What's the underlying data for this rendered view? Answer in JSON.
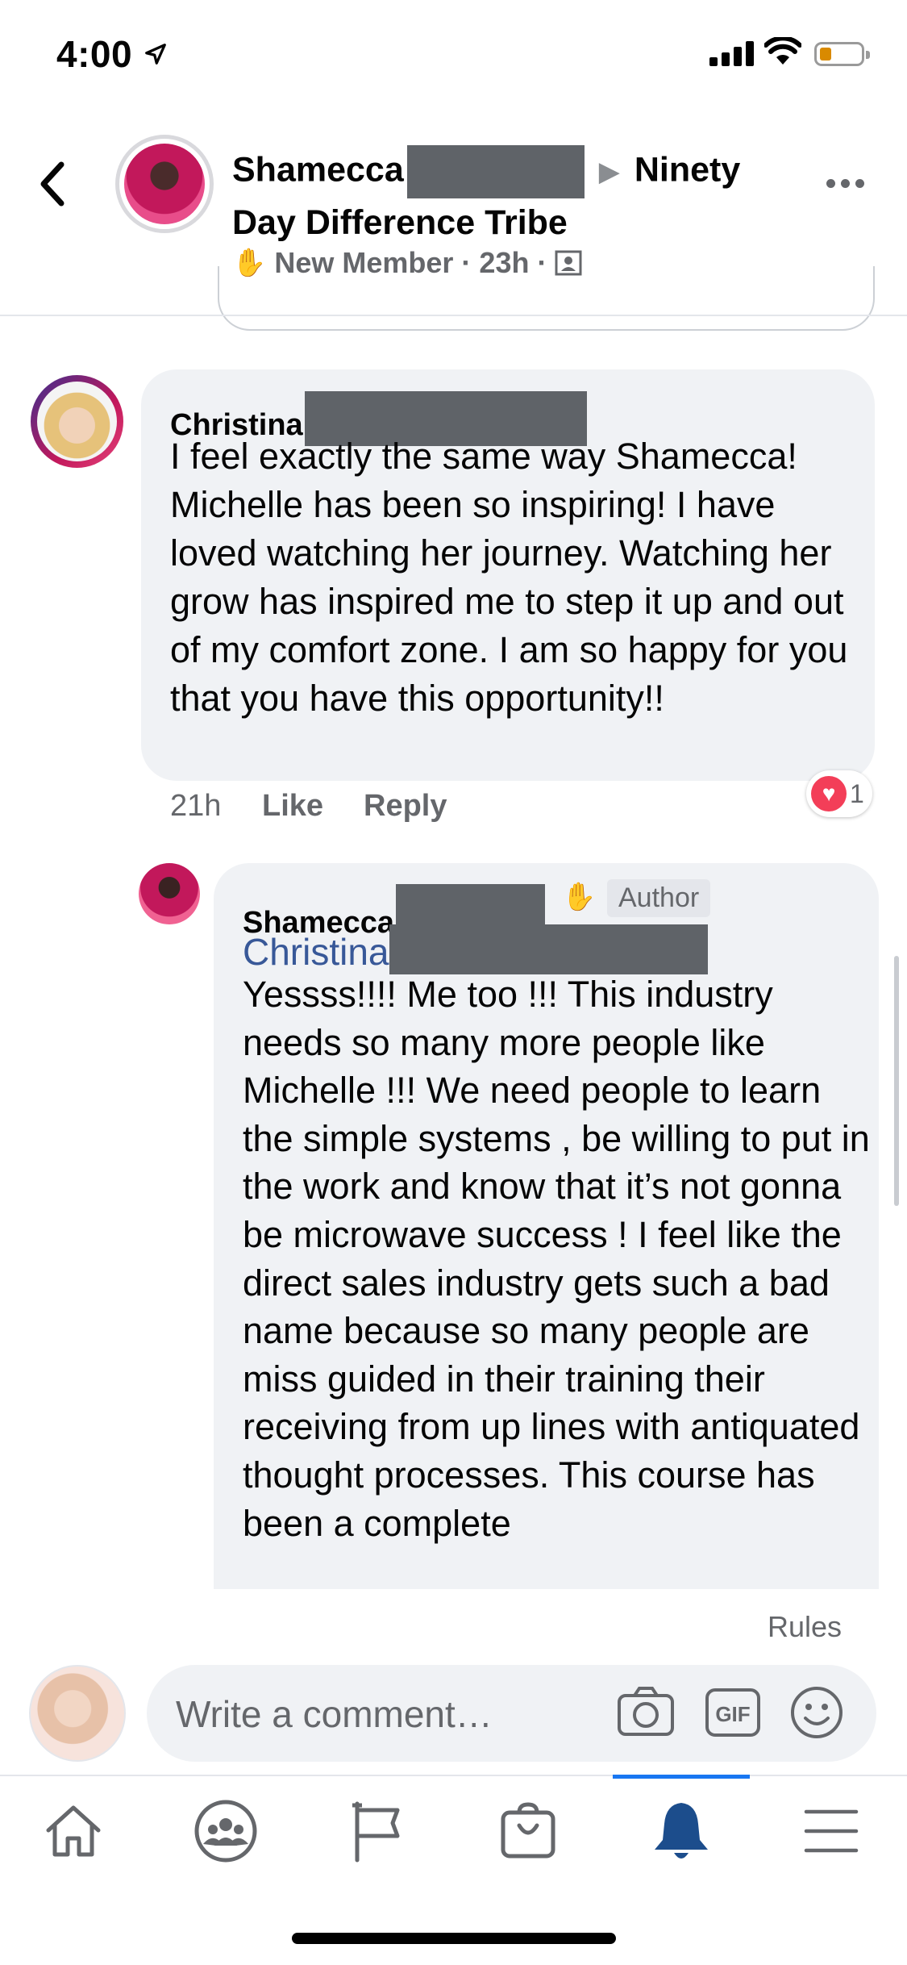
{
  "status_bar": {
    "time": "4:00"
  },
  "header": {
    "title_name": "Shamecca",
    "title_group": "Ninety Day Difference Tribe",
    "meta_badge": "New Member",
    "meta_sep": "·",
    "meta_time": "23h",
    "meta_sep2": "·"
  },
  "comments": [
    {
      "author": "Christina",
      "text": "I feel exactly the same way Shamecca! Michelle has been so inspiring! I have loved watching her journey. Watching her grow has inspired me to step it up and out of my comfort zone. I am so happy for you that you have this opportunity!!",
      "time": "21h",
      "like_label": "Like",
      "reply_label": "Reply",
      "reaction_count": "1"
    },
    {
      "author": "Shamecca",
      "badge": "Author",
      "mention": "Christina",
      "text": "Yessss!!!! Me too !!! This industry needs so many more people like Michelle !!! We need people to learn the simple systems , be willing to put in the work and know that it’s not gonna be microwave success ! I feel like the direct sales industry gets such a bad name because so many people are miss guided in their training their receiving from up lines with antiquated thought processes. This course has been a complete"
    }
  ],
  "composer": {
    "rules_label": "Rules",
    "placeholder": "Write a comment…"
  },
  "icons": {
    "back": "chevron-left-icon",
    "more": "more-dots-icon",
    "camera": "camera-icon",
    "gif": "gif-icon",
    "emoji": "emoji-icon",
    "tabs": [
      "home-icon",
      "groups-icon",
      "pages-flag-icon",
      "marketplace-icon",
      "notifications-bell-icon",
      "menu-icon"
    ]
  },
  "colors": {
    "accent": "#1877f2",
    "mention": "#385898",
    "reaction": "#f33e58",
    "bubble": "#f0f2f5"
  }
}
